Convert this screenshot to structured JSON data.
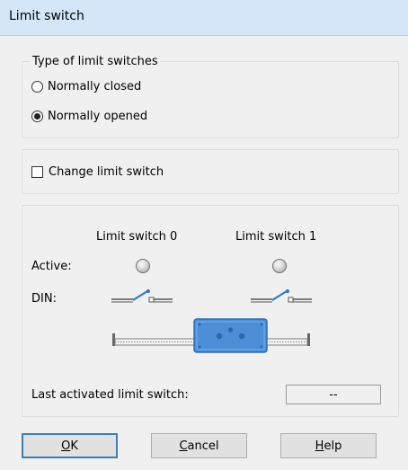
{
  "window": {
    "title": "Limit switch"
  },
  "type_group": {
    "title": "Type of limit switches",
    "options": [
      {
        "label": "Normally closed",
        "selected": false
      },
      {
        "label": "Normally opened",
        "selected": true
      }
    ]
  },
  "change_limit_switch": {
    "label": "Change limit switch",
    "checked": false
  },
  "status": {
    "switch0_label": "Limit switch 0",
    "switch1_label": "Limit switch 1",
    "active_label": "Active:",
    "din_label": "DIN:",
    "last_activated_label": "Last activated limit switch:",
    "last_activated_value": "--"
  },
  "buttons": {
    "ok": {
      "mnemonic": "O",
      "rest": "K"
    },
    "cancel": {
      "mnemonic": "C",
      "rest": "ancel"
    },
    "help": {
      "mnemonic": "H",
      "rest": "elp"
    }
  },
  "colors": {
    "carriage": "#4a8fd8",
    "titlebar": "#d4e6f8",
    "default_button_border": "#3c7fb1"
  }
}
